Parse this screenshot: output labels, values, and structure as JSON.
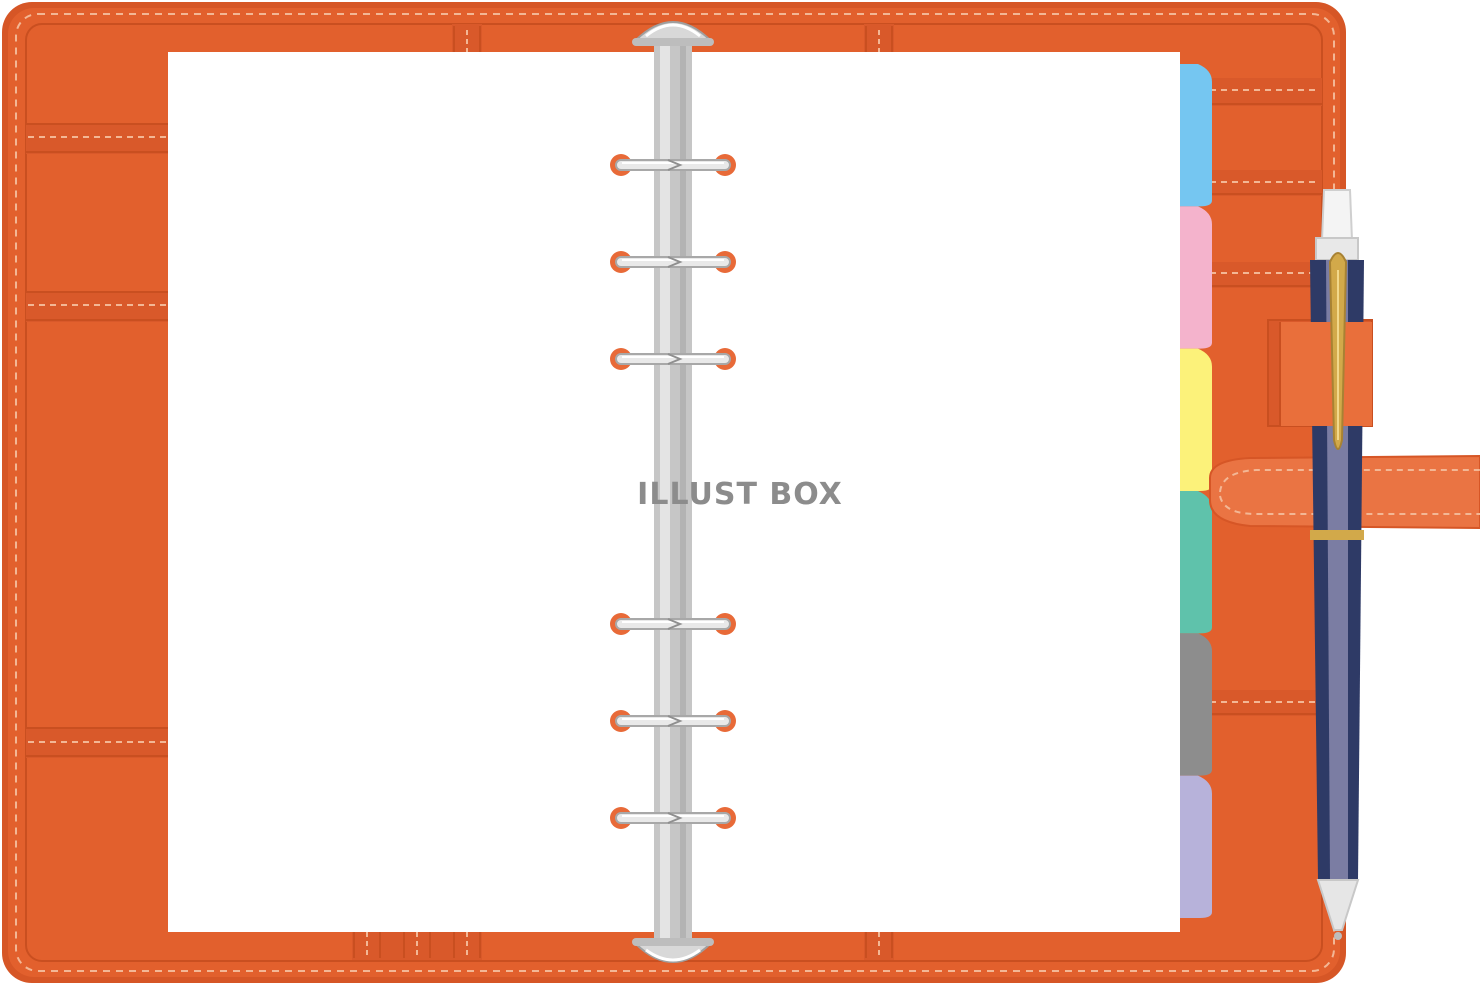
{
  "watermark": {
    "text": "ILLUST BOX"
  },
  "colors": {
    "leather": "#e2602d",
    "leather_dark": "#c94f20",
    "leather_light": "#ea7443",
    "stitch": "#f3b795",
    "paper": "#ffffff",
    "spine": "#c6c6c6",
    "spine_light": "#e4e4e4",
    "ring_eyelet": "#e86a38",
    "pen_body": "#2e3a66",
    "pen_band": "#7b7da3",
    "pen_clip": "#d2a94a",
    "pen_tip": "#e6e6e6"
  },
  "tabs": [
    {
      "name": "blue-tab",
      "color": "#75c6f1"
    },
    {
      "name": "pink-tab",
      "color": "#f4b3cc"
    },
    {
      "name": "yellow-tab",
      "color": "#fcf27a"
    },
    {
      "name": "teal-tab",
      "color": "#5fc2ab"
    },
    {
      "name": "gray-tab",
      "color": "#8d8d8d"
    },
    {
      "name": "lavender-tab",
      "color": "#b7b2da"
    }
  ],
  "rings": {
    "upper_count": 3,
    "lower_count": 3
  }
}
